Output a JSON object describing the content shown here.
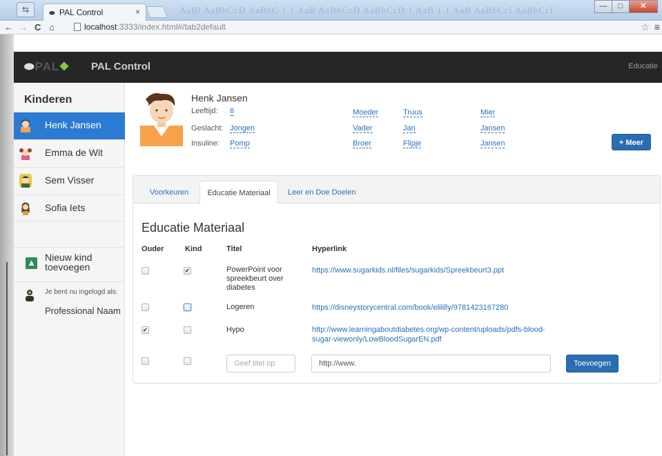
{
  "browser": {
    "tab_title": "PAL Control",
    "tab_close": "×",
    "url_host": "localhost",
    "url_rest": ":3333/index.html#/tab2default",
    "back_icon": "←",
    "forward_icon": "→",
    "reload_icon": "C",
    "home_icon": "⌂",
    "star_icon": "☆",
    "menu_icon": "≡",
    "ghost_text": "AaBl AaBbCcD AaBbC 1.1 AaB AaBbCcD AaBbCcD 1 AaB 1.1 AaB AaBbCcI AaBbCcI",
    "win_min": "—",
    "win_max": "□",
    "win_close": "✕"
  },
  "navbar": {
    "logo": "PAL",
    "brand": "PAL Control",
    "right": "Educatie"
  },
  "sidebar": {
    "title": "Kinderen",
    "kids": [
      {
        "name": "Henk Jansen",
        "active": true
      },
      {
        "name": "Emma de Wit",
        "active": false
      },
      {
        "name": "Sem Visser",
        "active": false
      },
      {
        "name": "Sofia Iets",
        "active": false
      }
    ],
    "new_kid": "Nieuw kind toevoegen",
    "logged_in_prefix": "Je bent nu ingelogd als:",
    "logged_in_user": "Professional Naam"
  },
  "profile": {
    "name": "Henk Jansen",
    "fields": [
      {
        "label": "Leeftijd:",
        "value": "6"
      },
      {
        "label": "Geslacht:",
        "value": "Jongen"
      },
      {
        "label": "Insuline:",
        "value": "Pomp"
      }
    ],
    "relations": [
      {
        "role": "Moeder",
        "first": "Truus",
        "last": "Mier"
      },
      {
        "role": "Vader",
        "first": "Jan",
        "last": "Jansen"
      },
      {
        "role": "Broer",
        "first": "Flipje",
        "last": "Jansen"
      }
    ],
    "more_button": "+ Meer"
  },
  "tabs": {
    "items": [
      "Voorkeuren",
      "Educatie Materiaal",
      "Leer en Doe Doelen"
    ],
    "active": "Educatie Materiaal"
  },
  "education": {
    "title": "Educatie Materiaal",
    "headers": [
      "Ouder",
      "Kind",
      "Titel",
      "Hyperlink"
    ],
    "rows": [
      {
        "ouder": false,
        "kind": true,
        "title": "PowerPoint voor spreekbeurt over diabetes",
        "link": "https://www.sugarkids.nl/files/sugarkids/Spreekbeurt3.ppt"
      },
      {
        "ouder": false,
        "kind": false,
        "title": "Logeren",
        "link": "https://disneystorycentral.com/book/elililly/9781423167280"
      },
      {
        "ouder": true,
        "kind": false,
        "title": "Hypo",
        "link": "http://www.learningaboutdiabetes.org/wp-content/uploads/pdfs-blood-sugar-viewonly/LowBloodSugarEN.pdf"
      }
    ],
    "new_title_placeholder": "Geef titel op",
    "new_link_value": "http://www.",
    "add_button": "Toevoegen",
    "check_glyph": "✔"
  }
}
